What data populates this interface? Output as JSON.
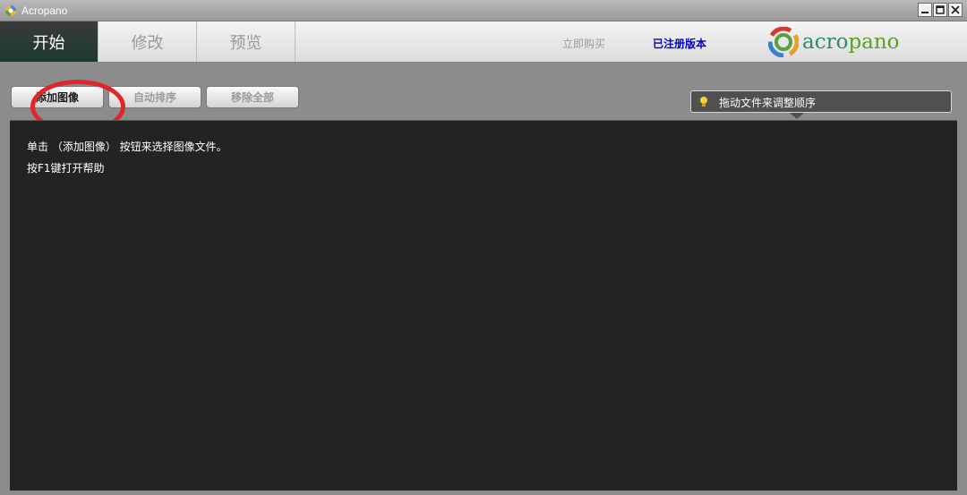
{
  "window": {
    "title": "Acropano",
    "controls": [
      "minimize",
      "maximize",
      "close"
    ]
  },
  "tabs": [
    {
      "label": "开始",
      "active": true
    },
    {
      "label": "修改",
      "active": false
    },
    {
      "label": "预览",
      "active": false
    }
  ],
  "header": {
    "buy_link": "立即购买",
    "registered_link": "已注册版本",
    "logo_acro": "acro",
    "logo_pano": "pano"
  },
  "toolbar": {
    "add_images": "添加图像",
    "auto_sort": "自动排序",
    "remove_all": "移除全部"
  },
  "tip": {
    "text": "拖动文件来调整顺序",
    "icon": "lightbulb-icon"
  },
  "content": {
    "line1": "单击 （添加图像） 按钮来选择图像文件。",
    "line2": "按F1键打开帮助"
  },
  "colors": {
    "accent_red": "#e0262a",
    "registered_blue": "#0000cc",
    "content_bg": "#232323",
    "active_tab_bg": "#1c3a30"
  }
}
